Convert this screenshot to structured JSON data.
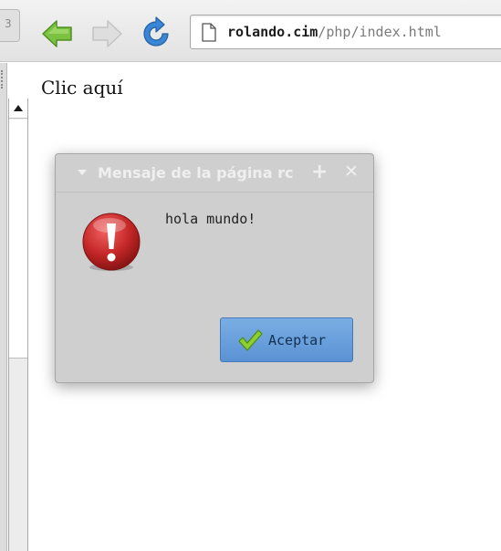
{
  "browser": {
    "tab_stub_glyph": "3",
    "url_host": "rolando.cim",
    "url_path": "/php/index.html",
    "icons": {
      "back": "back-arrow-icon",
      "forward": "forward-arrow-icon",
      "reload": "reload-icon",
      "page": "page-icon"
    },
    "colors": {
      "back_arrow": "#7cc242",
      "forward_arrow_disabled": "#d6d6d6",
      "reload": "#3a86d6"
    }
  },
  "page": {
    "link_text": "Clic aquí"
  },
  "dialog": {
    "title": "Mensaje de la página rc",
    "title_plus": "+",
    "title_close": "✕",
    "message": "hola mundo!",
    "accept_label": "Aceptar",
    "icons": {
      "alert": "error-icon",
      "accept": "check-icon",
      "menu": "dialog-menu-icon"
    },
    "colors": {
      "error_red": "#c62828",
      "button_blue": "#5b92d4",
      "check_green": "#8ccf2f"
    }
  }
}
